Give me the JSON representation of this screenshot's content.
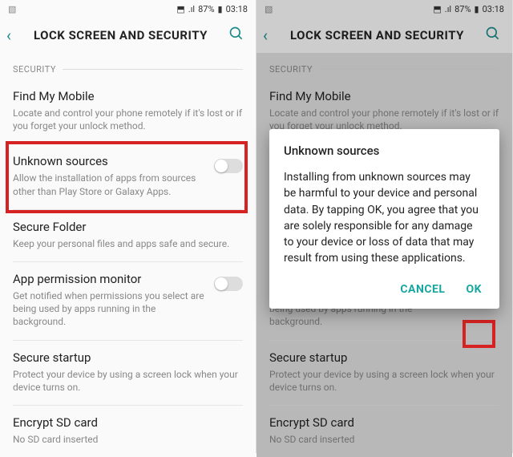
{
  "status": {
    "battery": "87%",
    "time": "03:18"
  },
  "header": {
    "title": "LOCK SCREEN AND SECURITY"
  },
  "section_label": "SECURITY",
  "items": {
    "find": {
      "title": "Find My Mobile",
      "desc": "Locate and control your phone remotely if it's lost or if you forget your unlock method."
    },
    "unknown": {
      "title": "Unknown sources",
      "desc": "Allow the installation of apps from sources other than Play Store or Galaxy Apps."
    },
    "folder": {
      "title": "Secure Folder",
      "desc": "Keep your personal files and apps safe and secure."
    },
    "perm": {
      "title": "App permission monitor",
      "desc": "Get notified when permissions you select are being used by apps running in the background."
    },
    "startup": {
      "title": "Secure startup",
      "desc": "Protect your device by using a screen lock when your device turns on."
    },
    "encrypt": {
      "title": "Encrypt SD card",
      "desc": "No SD card inserted"
    }
  },
  "dialog": {
    "title": "Unknown sources",
    "body": "Installing from unknown sources may be harmful to your device and personal data. By tapping OK, you agree that you are solely responsible for any damage to your device or loss of data that may result from using these applications.",
    "cancel": "CANCEL",
    "ok": "OK"
  }
}
